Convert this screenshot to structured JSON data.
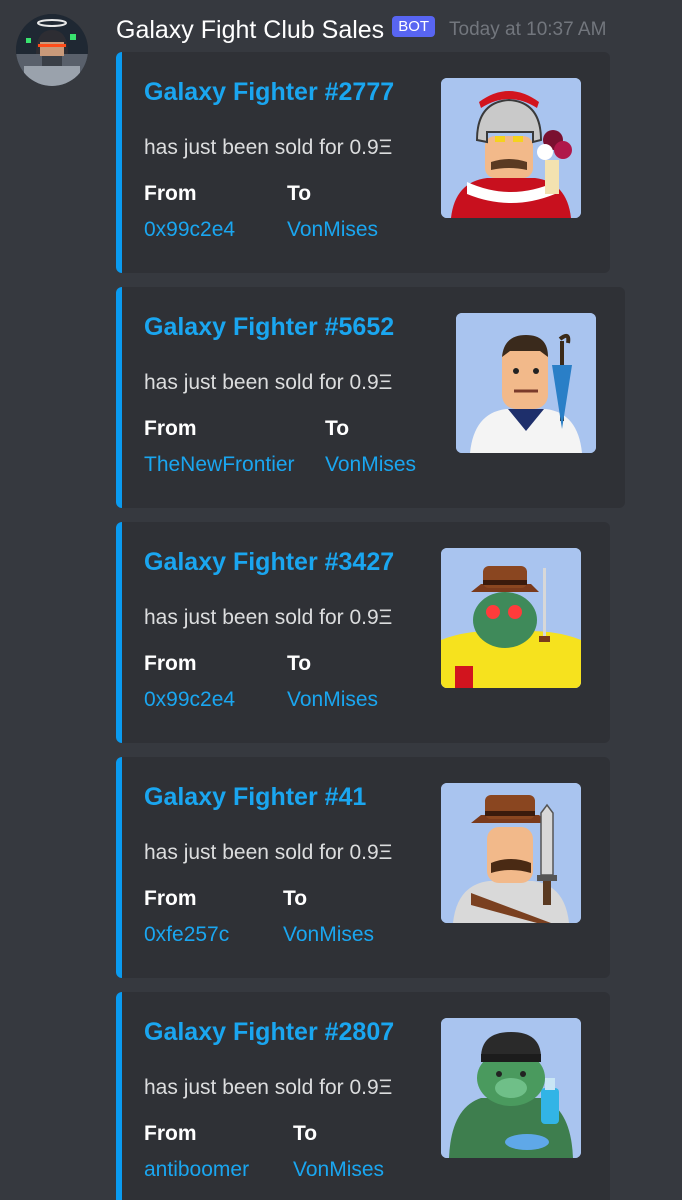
{
  "message": {
    "username": "Galaxy Fight Club Sales",
    "badge": "BOT",
    "timestamp": "Today at 10:37 AM",
    "avatar_icon": "astronaut-fighter-avatar-icon"
  },
  "embeds": [
    {
      "title": "Galaxy Fighter #2777",
      "description": "has just been sold for 0.9Ξ",
      "from_label": "From",
      "from_value": "0x99c2e4",
      "to_label": "To",
      "to_value": "VonMises",
      "thumbnail_icon": "roman-helmet-fighter-icon"
    },
    {
      "title": "Galaxy Fighter #5652",
      "description": "has just been sold for 0.9Ξ",
      "from_label": "From",
      "from_value": "TheNewFrontier",
      "to_label": "To",
      "to_value": "VonMises",
      "thumbnail_icon": "sailor-umbrella-fighter-icon"
    },
    {
      "title": "Galaxy Fighter #3427",
      "description": "has just been sold for 0.9Ξ",
      "from_label": "From",
      "from_value": "0x99c2e4",
      "to_label": "To",
      "to_value": "VonMises",
      "thumbnail_icon": "green-bear-fedora-fighter-icon"
    },
    {
      "title": "Galaxy Fighter #41",
      "description": "has just been sold for 0.9Ξ",
      "from_label": "From",
      "from_value": "0xfe257c",
      "to_label": "To",
      "to_value": "VonMises",
      "thumbnail_icon": "cowboy-knife-fighter-icon"
    },
    {
      "title": "Galaxy Fighter #2807",
      "description": "has just been sold for 0.9Ξ",
      "from_label": "From",
      "from_value": "antiboomer",
      "to_label": "To",
      "to_value": "VonMises",
      "thumbnail_icon": "green-bear-beanie-fighter-icon"
    }
  ],
  "colors": {
    "background": "#36393f",
    "embed_background": "#2f3136",
    "embed_accent": "#0a9bf0",
    "link": "#1aa6f0",
    "badge": "#5865f2",
    "thumbnail_background": "#a9c4ef"
  }
}
